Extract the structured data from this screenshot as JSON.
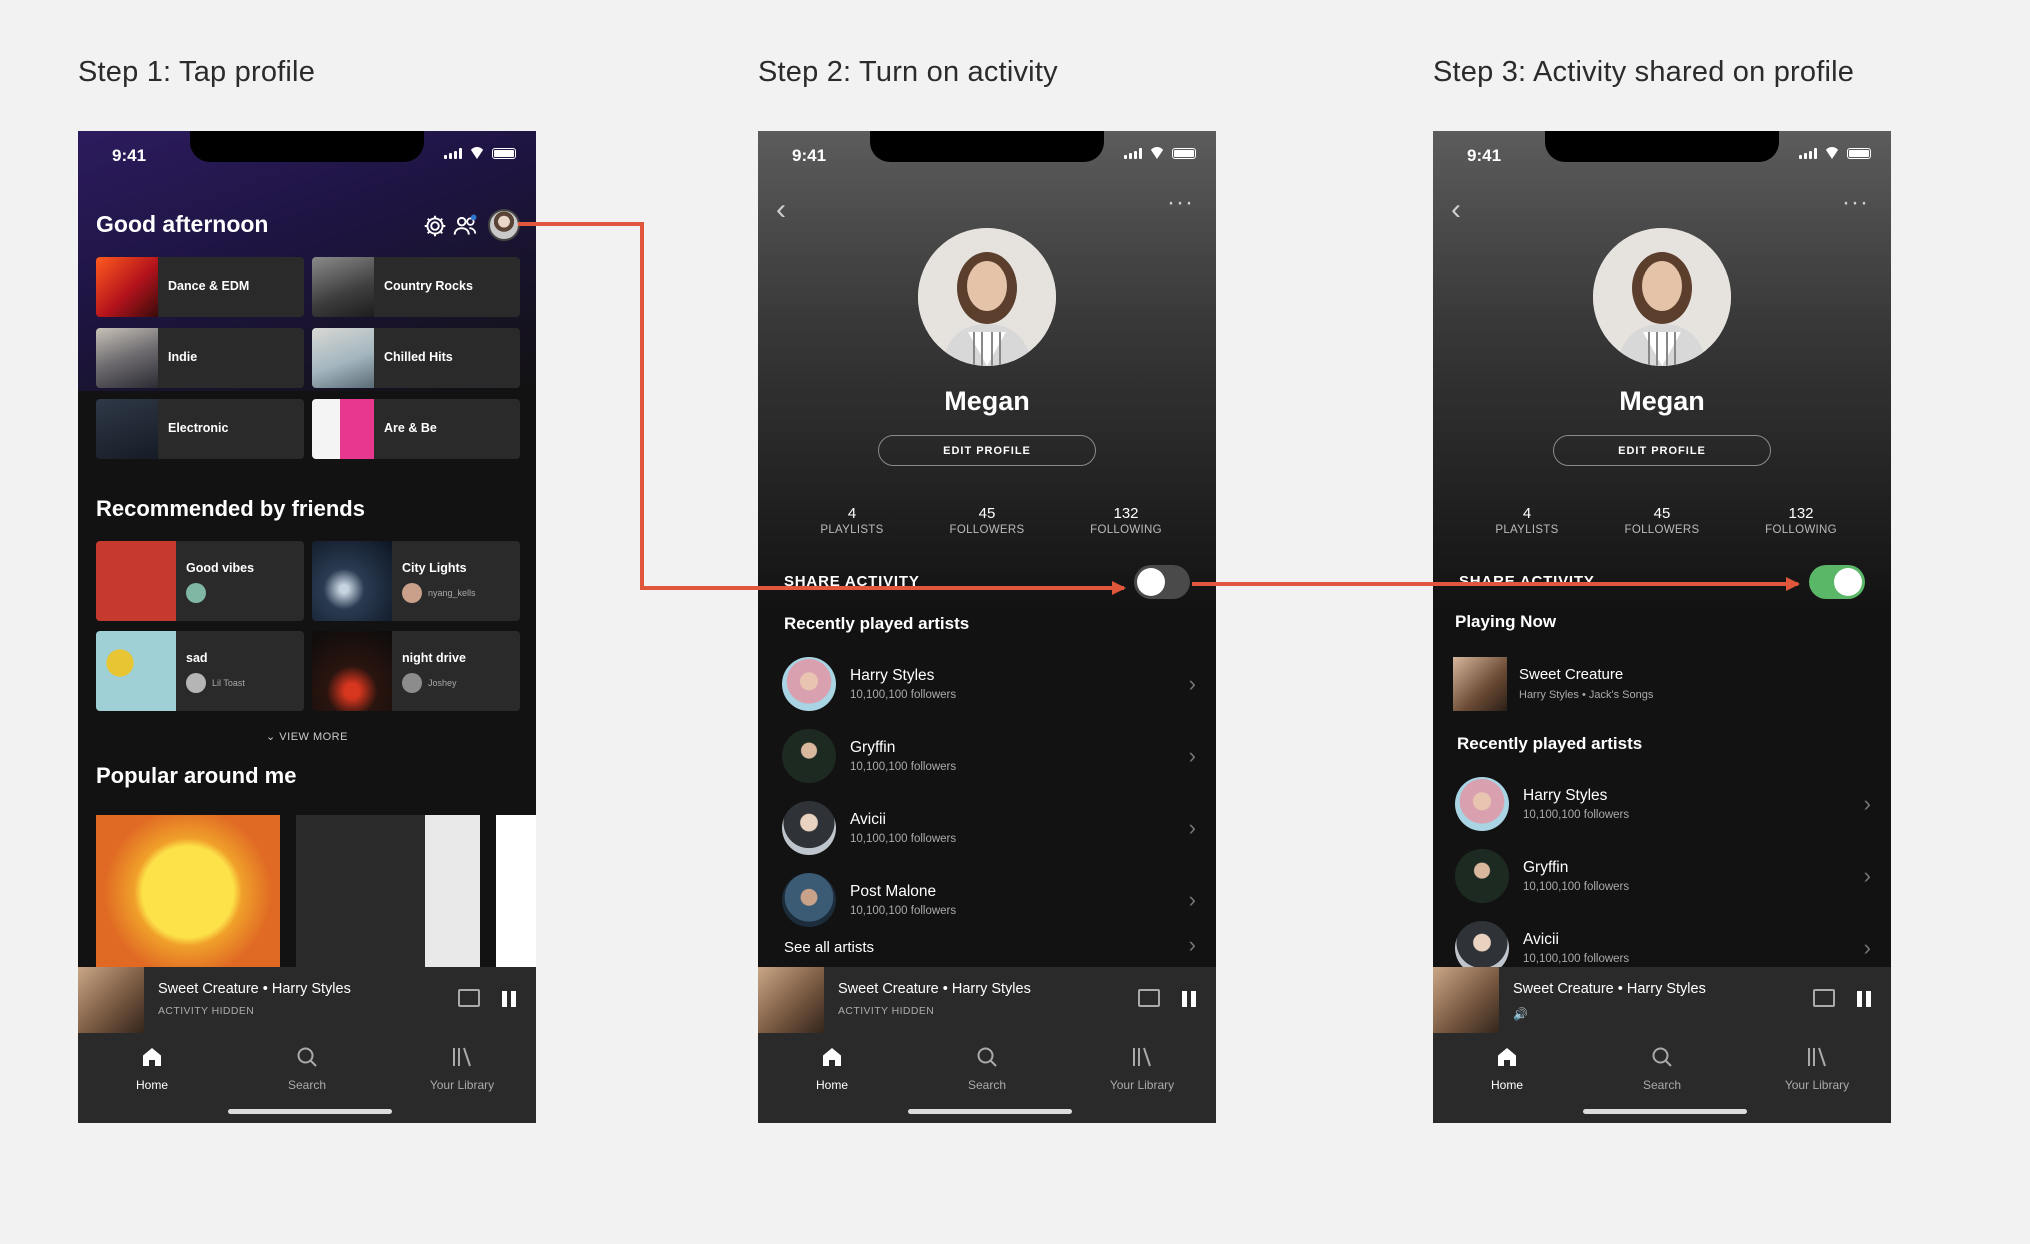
{
  "steps": [
    {
      "title": "Step 1: Tap profile"
    },
    {
      "title": "Step 2: Turn on activity"
    },
    {
      "title": "Step 3: Activity shared on profile"
    }
  ],
  "status_time": "9:41",
  "home": {
    "greeting": "Good afternoon",
    "tiles": [
      {
        "label": "Dance & EDM"
      },
      {
        "label": "Country Rocks"
      },
      {
        "label": "Indie"
      },
      {
        "label": "Chilled Hits"
      },
      {
        "label": "Electronic"
      },
      {
        "label": "Are & Be"
      }
    ],
    "recommended_title": "Recommended by friends",
    "recommended": [
      {
        "label": "Good vibes",
        "by": ""
      },
      {
        "label": "City Lights",
        "by": "nyang_kells"
      },
      {
        "label": "sad",
        "by": "Lil Toast"
      },
      {
        "label": "night drive",
        "by": "Joshey"
      }
    ],
    "view_more": "VIEW MORE",
    "popular_title": "Popular around me"
  },
  "profile": {
    "name": "Megan",
    "edit_label": "EDIT PROFILE",
    "stats": [
      {
        "value": "4",
        "label": "PLAYLISTS"
      },
      {
        "value": "45",
        "label": "FOLLOWERS"
      },
      {
        "value": "132",
        "label": "FOLLOWING"
      }
    ],
    "share_label": "SHARE ACTIVITY",
    "playing_now_title": "Playing Now",
    "playing_now": {
      "title": "Sweet Creature",
      "subtitle": "Harry Styles • Jack's Songs"
    },
    "recent_title": "Recently played artists",
    "artists": [
      {
        "name": "Harry Styles",
        "followers": "10,100,100 followers"
      },
      {
        "name": "Gryffin",
        "followers": "10,100,100 followers"
      },
      {
        "name": "Avicii",
        "followers": "10,100,100 followers"
      },
      {
        "name": "Post Malone",
        "followers": "10,100,100 followers"
      }
    ],
    "see_all": "See all artists"
  },
  "mini_player": {
    "track": "Sweet Creature • Harry Styles",
    "status": "ACTIVITY HIDDEN"
  },
  "nav": {
    "home": "Home",
    "search": "Search",
    "library": "Your Library"
  },
  "toggle_states": {
    "step2": "off",
    "step3": "on"
  },
  "colors": {
    "arrow": "#e0573b",
    "toggle_on": "#5bb768",
    "spotify_green": "#1db954"
  }
}
